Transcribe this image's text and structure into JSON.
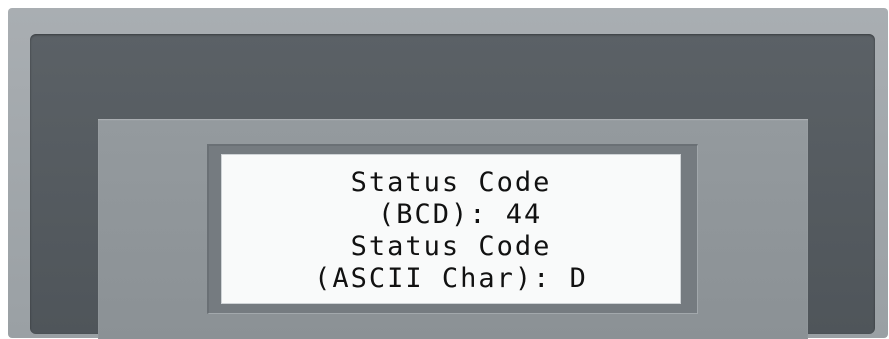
{
  "lcd": {
    "line1": "Status Code",
    "line2": " (BCD): 44",
    "line3": "Status Code",
    "line4": "(ASCII Char): D"
  }
}
